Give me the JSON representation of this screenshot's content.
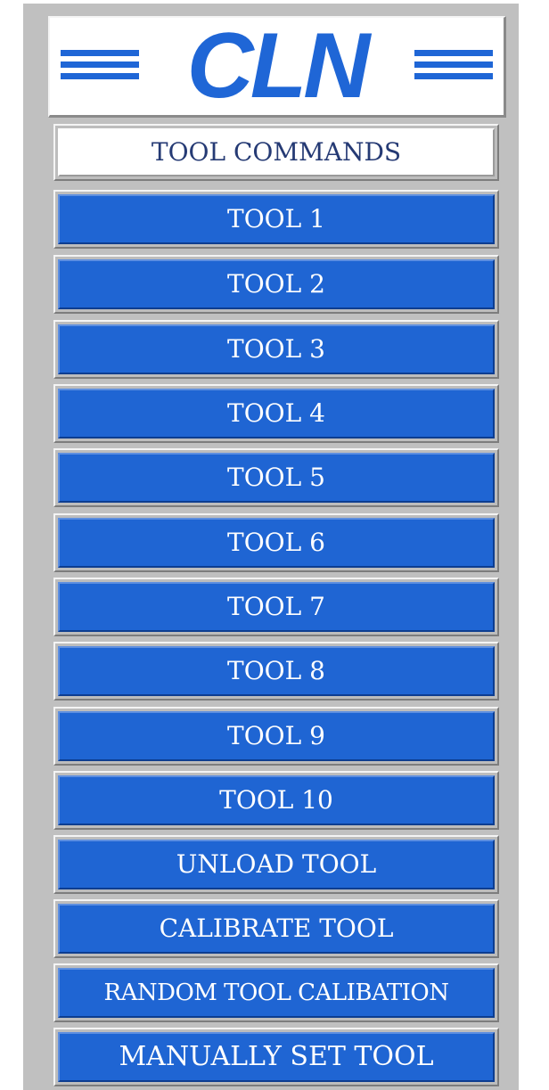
{
  "logo": {
    "text": "CLN"
  },
  "header": {
    "label": "TOOL COMMANDS"
  },
  "buttons": [
    {
      "label": "TOOL  1"
    },
    {
      "label": "TOOL  2"
    },
    {
      "label": "TOOL  3"
    },
    {
      "label": "TOOL  4"
    },
    {
      "label": "TOOL  5"
    },
    {
      "label": "TOOL  6"
    },
    {
      "label": "TOOL  7"
    },
    {
      "label": "TOOL  8"
    },
    {
      "label": "TOOL  9"
    },
    {
      "label": "TOOL  10"
    },
    {
      "label": "UNLOAD TOOL"
    },
    {
      "label": "CALIBRATE TOOL"
    },
    {
      "label": "RANDOM TOOL CALIBATION"
    },
    {
      "label": "MANUALLY SET TOOL"
    }
  ],
  "colors": {
    "accent": "#1f65d3",
    "panel": "#c0c0c0",
    "header_text": "#253a74"
  }
}
